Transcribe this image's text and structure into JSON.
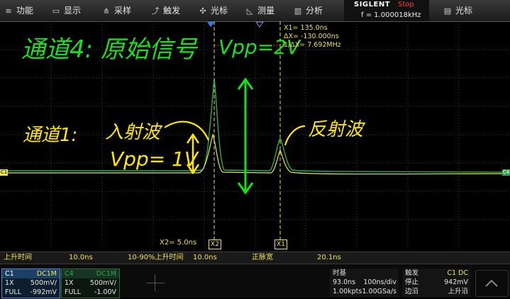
{
  "menu": {
    "items": [
      {
        "label": "功能",
        "icon": "function-icon"
      },
      {
        "label": "显示",
        "icon": "display-icon"
      },
      {
        "label": "采样",
        "icon": "acquire-icon"
      },
      {
        "label": "触发",
        "icon": "trigger-icon"
      },
      {
        "label": "光标",
        "icon": "cursor-icon"
      },
      {
        "label": "测量",
        "icon": "measure-icon"
      },
      {
        "label": "分析",
        "icon": "analysis-icon"
      }
    ],
    "right_item": {
      "label": "光标",
      "icon": "cursor-menu-icon"
    }
  },
  "brand": {
    "logo": "SIGLENT",
    "run_state": "Stop",
    "frequency": "f = 1.000018kHz"
  },
  "cursors": {
    "x1": "X1= 135.0ns",
    "delta_x": "ΔX= -130.000ns",
    "inv_delta_x": "1/ΔX= 7.692MHz",
    "x2": "X2= 5.0ns",
    "x1_tag": "X1",
    "x2_tag": "X2"
  },
  "channel_markers": {
    "left": "C1",
    "right": "C4"
  },
  "annotations": {
    "title": "通道4: 原始信号",
    "vpp_top": "Vpp=2V",
    "ch1_label": "通道1:",
    "incident": "入射波",
    "vpp_ch1": "Vpp= 1V",
    "reflected": "反射波"
  },
  "measurements": [
    {
      "name": "上升时间",
      "value": "10.0ns"
    },
    {
      "name": "10-90%上升时间",
      "value": "10.0ns"
    },
    {
      "name": "正脉宽",
      "value": "20.1ns"
    }
  ],
  "channels": [
    {
      "id": "C1",
      "coupling": "DC1M",
      "probe": "1X",
      "scale": "500mV/",
      "bw": "FULL",
      "offset": "-992mV"
    },
    {
      "id": "C4",
      "coupling": "DC1M",
      "probe": "1X",
      "scale": "500mV/",
      "bw": "FULL",
      "offset": "-1.00V"
    }
  ],
  "timebase": {
    "label": "时基",
    "delay": "93.0ns",
    "scale": "100ns/div",
    "memory": "1.00kpts",
    "sample_rate": "1.00GSa/s"
  },
  "trigger": {
    "label": "触发",
    "source": "C1 DC",
    "mode": "停止",
    "level": "942mV",
    "type_label": "边沿",
    "slope": "上升沿"
  },
  "colors": {
    "ch1": "#e8e84a",
    "ch4": "#2ea84a",
    "annotation_green": "#19e01a",
    "annotation_yellow": "#ffe600",
    "cursor": "#f1e04a",
    "stop": "#ff3b3b"
  }
}
